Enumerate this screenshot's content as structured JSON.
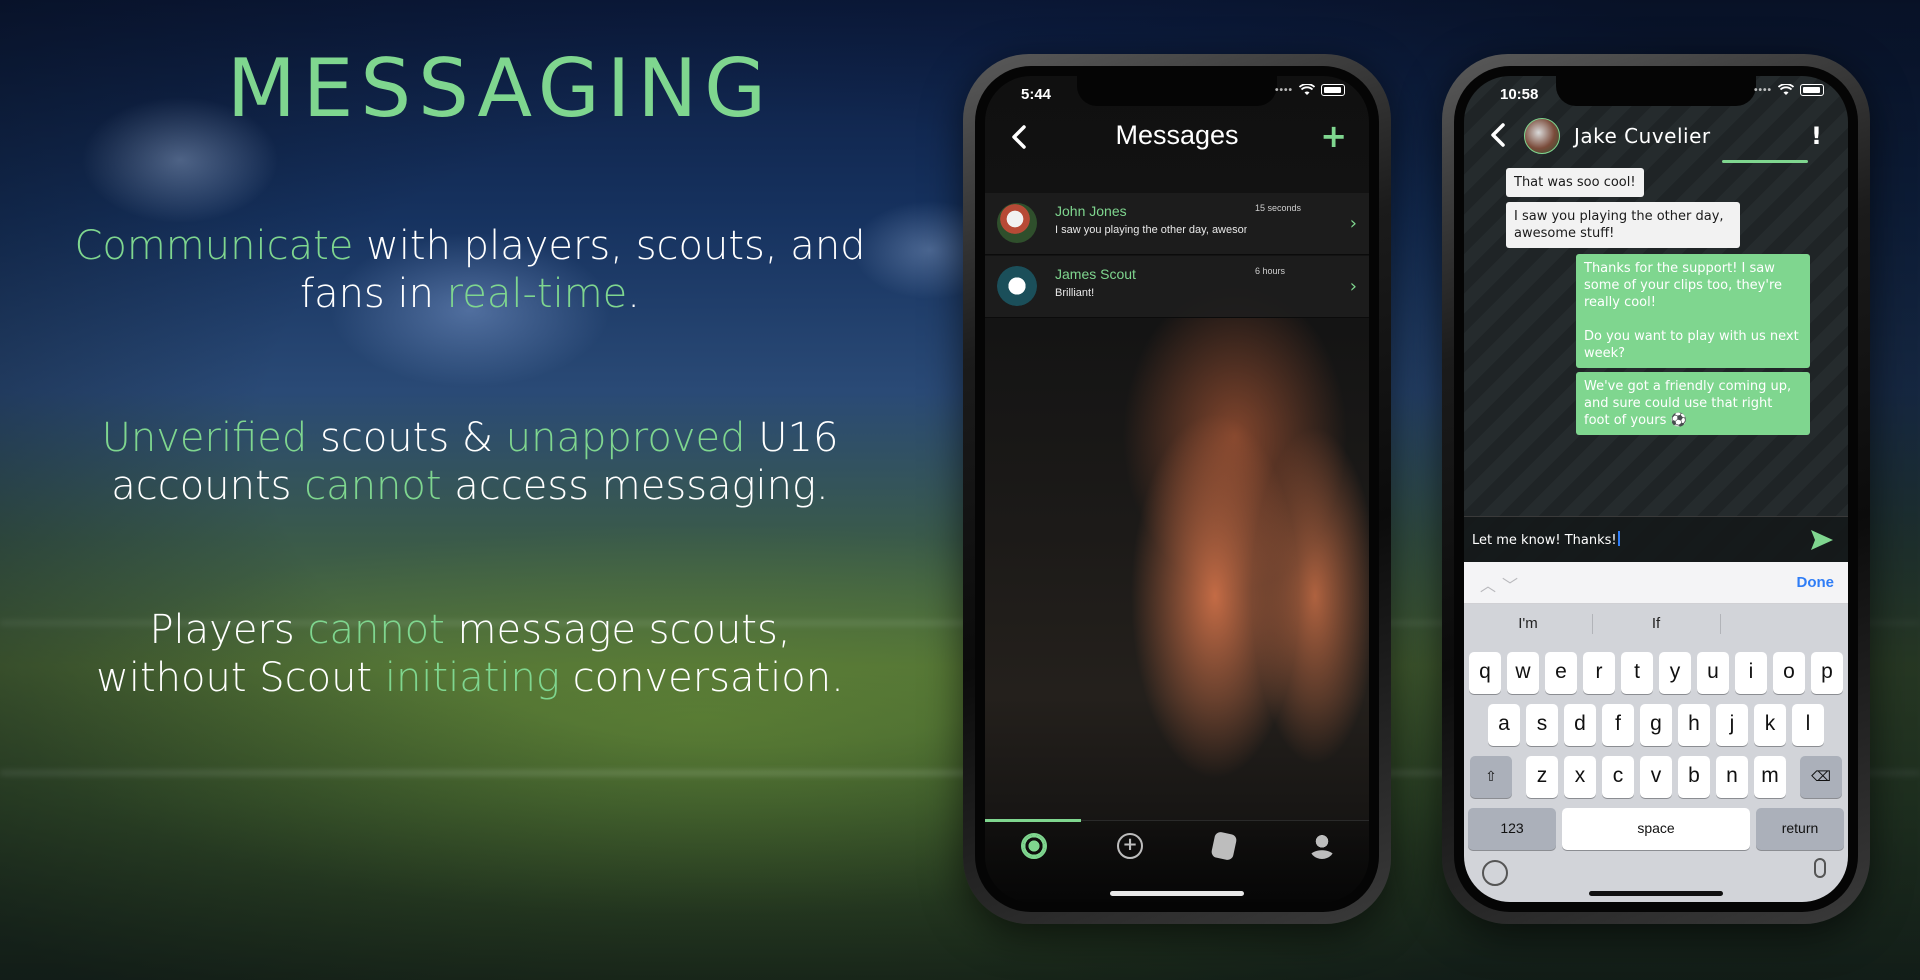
{
  "hero": {
    "title": "MESSAGING",
    "p1": {
      "a": "Communicate",
      "b": " with players, scouts, and",
      "c": "fans in ",
      "d": "real-time",
      "e": "."
    },
    "p2": {
      "a": "Unverified",
      "b": " scouts & ",
      "c": "unapproved",
      "d": " U16",
      "e": "accounts ",
      "f": "cannot",
      "g": " access messaging."
    },
    "p3": {
      "a": "Players ",
      "b": "cannot",
      "c": " message scouts,",
      "d": "without Scout ",
      "e": "initiating",
      "f": " conversation."
    }
  },
  "phone1": {
    "time": "5:44",
    "title": "Messages",
    "conversations": [
      {
        "name": "John Jones",
        "preview": "I saw you playing the other day, awesome stuff!",
        "time": "15 seconds"
      },
      {
        "name": "James Scout",
        "preview": "Brilliant!",
        "time": "6 hours"
      }
    ]
  },
  "phone2": {
    "time": "10:58",
    "contact": "Jake Cuvelier",
    "messages": [
      {
        "dir": "in",
        "text": "That was soo cool!"
      },
      {
        "dir": "in",
        "text": "I saw you playing the other day, awesome stuff!"
      },
      {
        "dir": "out",
        "text": "Thanks for the support! I saw some of your clips too, they're really cool!\n\nDo you want to play with us next week?"
      },
      {
        "dir": "out",
        "text": "We've got a friendly coming up, and sure could use that right foot of yours ⚽"
      }
    ],
    "composer_value": "Let me know! Thanks!",
    "done_label": "Done",
    "suggestions": [
      "I'm",
      "If",
      ""
    ],
    "keys": {
      "row1": [
        "q",
        "w",
        "e",
        "r",
        "t",
        "y",
        "u",
        "i",
        "o",
        "p"
      ],
      "row2": [
        "a",
        "s",
        "d",
        "f",
        "g",
        "h",
        "j",
        "k",
        "l"
      ],
      "row3": [
        "z",
        "x",
        "c",
        "v",
        "b",
        "n",
        "m"
      ],
      "numbers": "123",
      "space": "space",
      "return": "return"
    }
  },
  "colors": {
    "accent": "#7fd68f",
    "link_blue": "#2f7df6"
  }
}
